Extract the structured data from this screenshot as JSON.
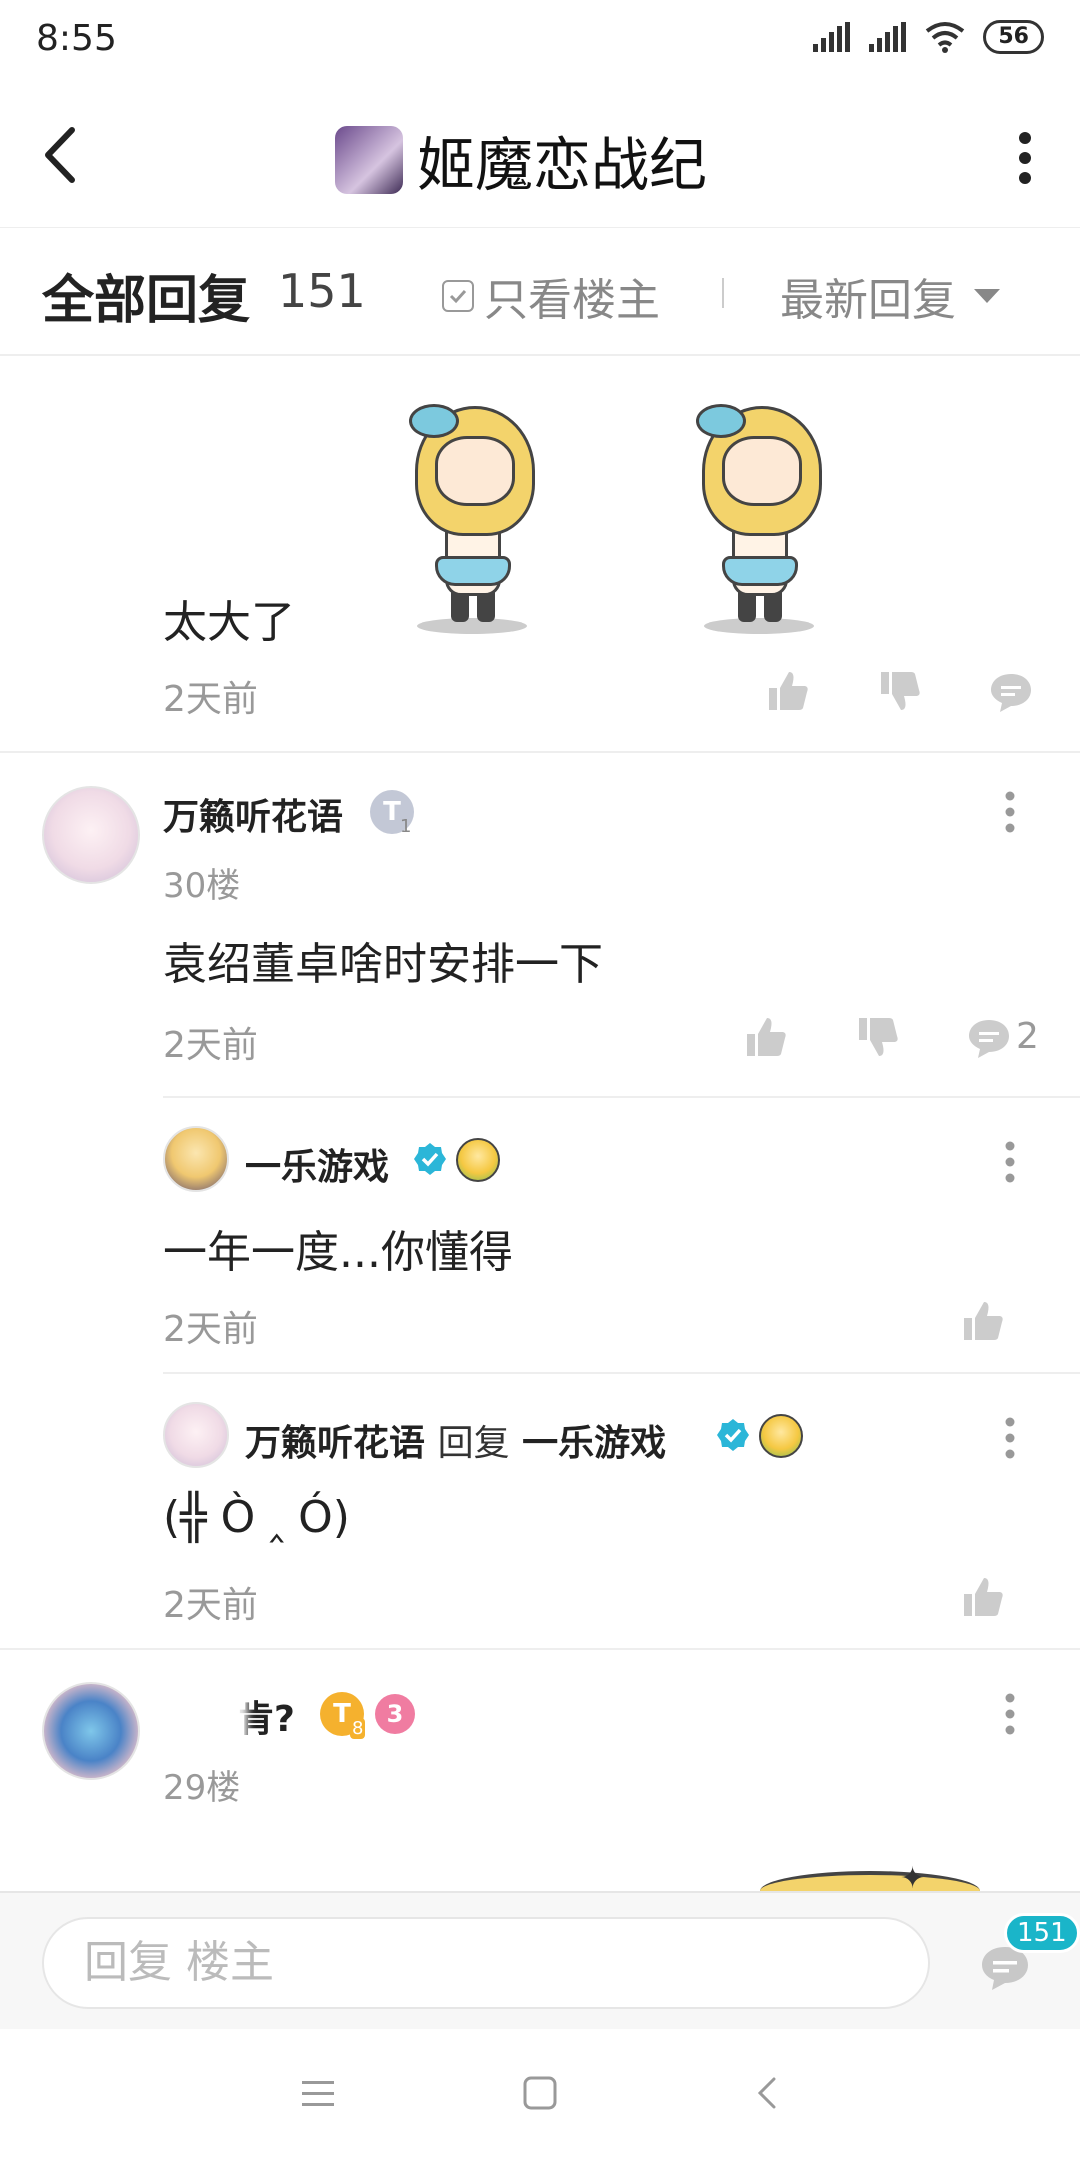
{
  "status_bar": {
    "time": "8:55",
    "battery": "56"
  },
  "header": {
    "title": "姬魔恋战纪"
  },
  "filter": {
    "all_replies": "全部回复",
    "count": "151",
    "only_op": "只看楼主",
    "sort": "最新回复"
  },
  "first_reply": {
    "text": "太大了",
    "time": "2天前"
  },
  "post_30": {
    "username": "万籁听花语",
    "badge": "T",
    "badge_level": "1",
    "floor": "30楼",
    "text": "袁绍董卓啥时安排一下",
    "time": "2天前",
    "comment_count": "2",
    "sub_replies": [
      {
        "username": "一乐游戏",
        "text": "一年一度...你懂得",
        "time": "2天前"
      },
      {
        "username": "万籁听花语",
        "reply_word": "回复",
        "reply_to": "一乐游戏",
        "text": "(╬ Ò ‸ Ó)",
        "time": "2天前"
      }
    ]
  },
  "post_29": {
    "username_partial": "肯?",
    "badge": "T",
    "badge_level": "8",
    "badge2": "3",
    "floor": "29楼"
  },
  "reply_bar": {
    "placeholder": "回复  楼主",
    "badge_count": "151"
  },
  "colors": {
    "accent": "#1ab5c9",
    "verified": "#2bb6d8",
    "gold_badge": "#f5b12e",
    "pink_badge": "#f07ca1"
  }
}
